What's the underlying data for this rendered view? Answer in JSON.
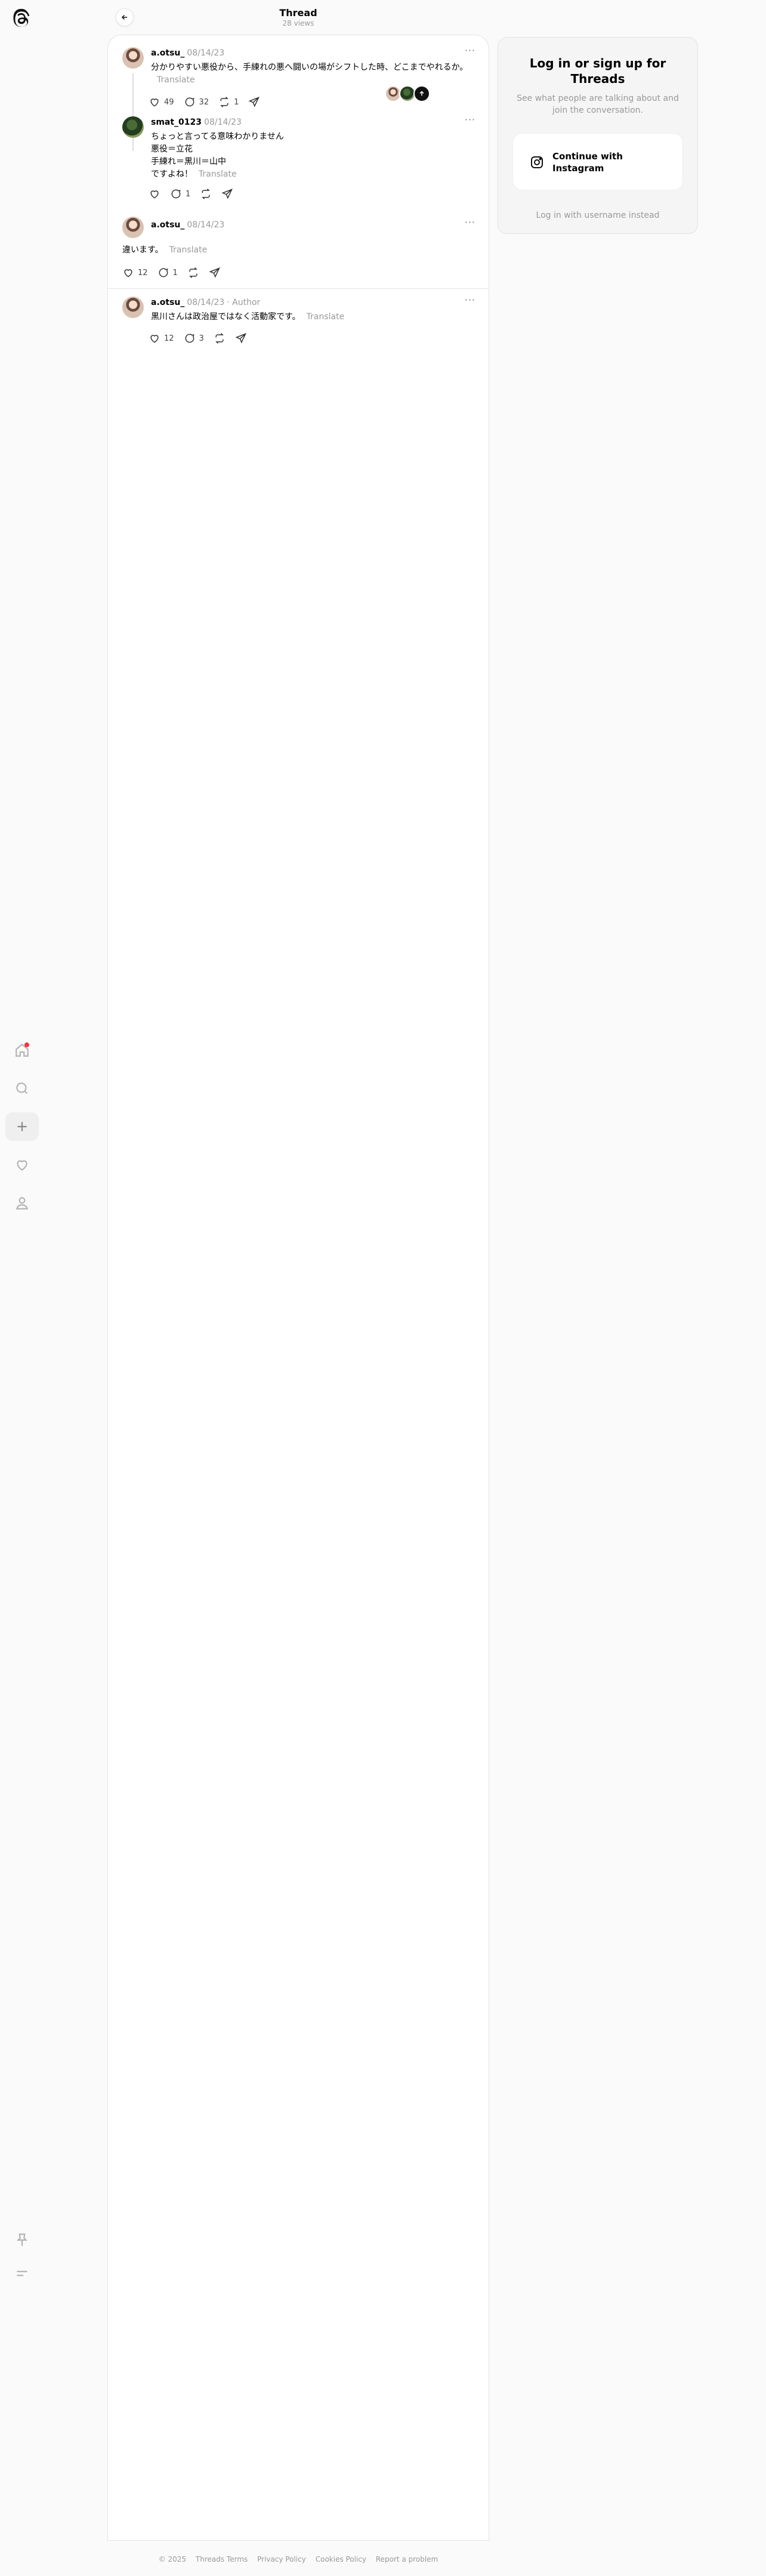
{
  "header": {
    "title": "Thread",
    "views": "28 views"
  },
  "posts": [
    {
      "username": "a.otsu_",
      "date": "08/14/23",
      "text": "分かりやすい悪役から、手練れの悪へ闘いの場がシフトした時、どこまでやれるか。",
      "translate": "Translate",
      "likes": "49",
      "replies": "32",
      "reposts": "1"
    },
    {
      "username": "smat_0123",
      "date": "08/14/23",
      "text_lines": [
        "ちょっと言ってる意味わかりません",
        "悪役＝立花",
        "手練れ＝黒川＝山中",
        "ですよね！"
      ],
      "translate": "Translate",
      "replies": "1"
    },
    {
      "username": "a.otsu_",
      "date": "08/14/23",
      "text": "違います。",
      "translate": "Translate",
      "likes": "12",
      "replies": "1"
    },
    {
      "username": "a.otsu_",
      "date": "08/14/23",
      "author_tag": "· Author",
      "text": "黒川さんは政治屋ではなく活動家です。",
      "translate": "Translate",
      "likes": "12",
      "replies": "3"
    }
  ],
  "more_label": "···",
  "login": {
    "title": "Log in or sign up for Threads",
    "subtitle": "See what people are talking about and join the conversation.",
    "instagram_button": "Continue with Instagram",
    "username_link": "Log in with username instead"
  },
  "footer": {
    "copyright": "© 2025",
    "links": [
      "Threads Terms",
      "Privacy Policy",
      "Cookies Policy",
      "Report a problem"
    ]
  },
  "icons": [
    "threads-logo-icon",
    "home-icon",
    "search-icon",
    "plus-icon",
    "heart-icon",
    "profile-icon",
    "pin-icon",
    "menu-icon",
    "back-arrow-icon",
    "like-icon",
    "reply-icon",
    "repost-icon",
    "share-icon",
    "instagram-icon"
  ],
  "colors": {
    "notification": "#ff3040",
    "muted": "#999999",
    "card_bg": "#ffffff",
    "page_bg": "#fafafa"
  }
}
